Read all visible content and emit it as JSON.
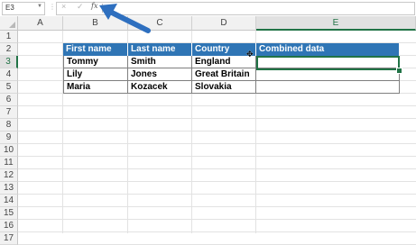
{
  "formula_bar": {
    "name_box": "E3",
    "cancel_icon": "×",
    "enter_icon": "✓",
    "fx_label": "fx",
    "content": ""
  },
  "columns": [
    "A",
    "B",
    "C",
    "D",
    "E"
  ],
  "rows": [
    "1",
    "2",
    "3",
    "4",
    "5",
    "6",
    "7",
    "8",
    "9",
    "10",
    "11",
    "12",
    "13",
    "14",
    "15",
    "16",
    "17"
  ],
  "selected_cell": {
    "column": "E",
    "row": "3"
  },
  "table": {
    "headers": [
      "First name",
      "Last name",
      "Country",
      "Combined data"
    ],
    "rows": [
      [
        "Tommy",
        "Smith",
        "England",
        ""
      ],
      [
        "Lily",
        "Jones",
        "Great Britain",
        ""
      ],
      [
        "Maria",
        "Kozacek",
        "Slovakia",
        ""
      ]
    ]
  },
  "colors": {
    "header_fill": "#2f75b5",
    "selection": "#217346",
    "annotation_arrow": "#2e6fbf"
  },
  "icons": {
    "annotation": "blue-arrow-icon",
    "cursor": "move-cursor-icon"
  }
}
